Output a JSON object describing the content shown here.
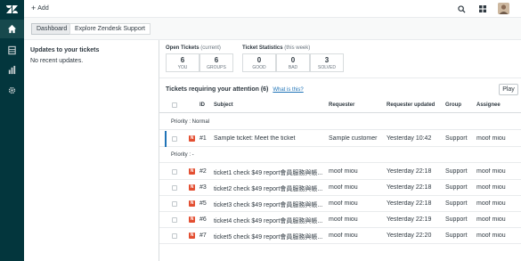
{
  "topbar": {
    "add_label": "Add"
  },
  "tabs": [
    {
      "label": "Dashboard"
    },
    {
      "label": "Explore Zendesk Support"
    }
  ],
  "updates": {
    "title": "Updates to your tickets",
    "empty_text": "No recent updates."
  },
  "open_tickets": {
    "title": "Open Tickets",
    "note": "(current)",
    "stats": [
      {
        "value": "6",
        "label": "YOU"
      },
      {
        "value": "6",
        "label": "GROUPS"
      }
    ]
  },
  "ticket_stats": {
    "title": "Ticket Statistics",
    "note": "(this week)",
    "stats": [
      {
        "value": "0",
        "label": "GOOD"
      },
      {
        "value": "0",
        "label": "BAD"
      },
      {
        "value": "3",
        "label": "SOLVED"
      }
    ]
  },
  "view": {
    "title": "Tickets requiring your attention (6)",
    "help_link": "What is this?",
    "play_label": "Play"
  },
  "columns": [
    "ID",
    "Subject",
    "Requester",
    "Requester updated",
    "Group",
    "Assignee"
  ],
  "groups": [
    {
      "label": "Priority : Normal",
      "rows": [
        {
          "status": "N",
          "id": "#1",
          "subject": "Sample ticket: Meet the ticket",
          "requester": "Sample customer",
          "updated": "Yesterday 10:42",
          "group": "Support",
          "assignee": "moof miou"
        }
      ]
    },
    {
      "label": "Priority : -",
      "rows": [
        {
          "status": "N",
          "id": "#2",
          "subject": "ticket1 check $49 report會員服務與帳...",
          "requester": "moof miou",
          "updated": "Yesterday 22:18",
          "group": "Support",
          "assignee": "moof miou"
        },
        {
          "status": "N",
          "id": "#3",
          "subject": "ticket2 check $49 report會員服務與帳...",
          "requester": "moof miou",
          "updated": "Yesterday 22:18",
          "group": "Support",
          "assignee": "moof miou"
        },
        {
          "status": "N",
          "id": "#5",
          "subject": "ticket3 check $49 report會員服務與帳...",
          "requester": "moof miou",
          "updated": "Yesterday 22:18",
          "group": "Support",
          "assignee": "moof miou"
        },
        {
          "status": "N",
          "id": "#6",
          "subject": "ticket4 check $49 report會員服務與帳...",
          "requester": "moof miou",
          "updated": "Yesterday 22:19",
          "group": "Support",
          "assignee": "moof miou"
        },
        {
          "status": "N",
          "id": "#7",
          "subject": "ticket5 check $49 report會員服務與帳...",
          "requester": "moof miou",
          "updated": "Yesterday 22:20",
          "group": "Support",
          "assignee": "moof miou"
        }
      ]
    }
  ],
  "icons": {
    "logo": "zendesk-logo",
    "rail": [
      "home-icon",
      "views-icon",
      "reporting-icon",
      "settings-icon"
    ],
    "top": [
      "search-icon",
      "apps-grid-icon"
    ]
  },
  "colors": {
    "rail_bg": "#03363d",
    "link": "#1f73b7",
    "status_new": "#e34f32"
  }
}
